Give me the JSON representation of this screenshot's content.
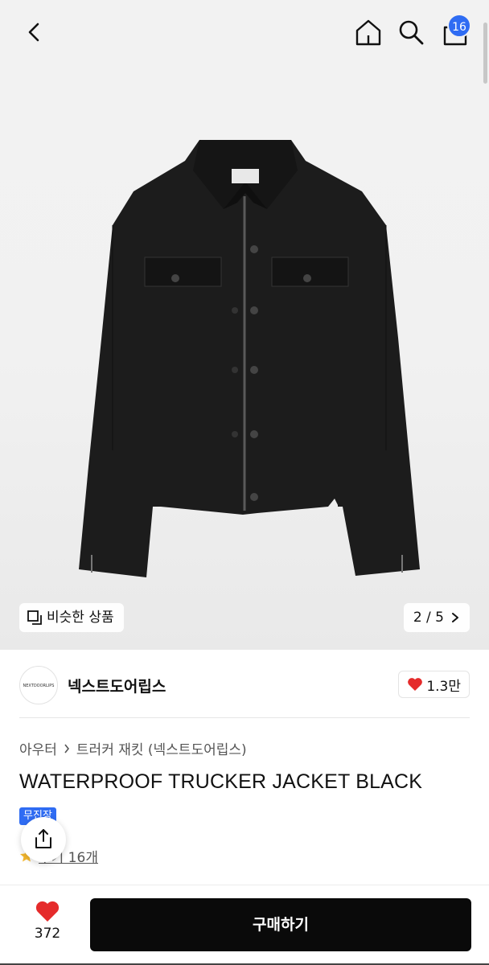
{
  "header": {
    "back_icon": "chevron-left-icon",
    "home_icon": "home-icon",
    "search_icon": "search-icon",
    "cart_icon": "shopping-bag-icon",
    "cart_badge": "16"
  },
  "gallery": {
    "similar_label": "비슷한 상품",
    "pager": "2 / 5"
  },
  "store": {
    "logo_text": "NEXTDOORLIPS",
    "name": "넥스트도어립스",
    "likes": "1.3만"
  },
  "breadcrumb": {
    "category": "아우터",
    "subcategory": "트러커 재킷 (넥스트도어립스)"
  },
  "product": {
    "title": "WATERPROOF TRUCKER JACKET BLACK",
    "badge": "무진장",
    "review_prefix": "후기",
    "review_text": "후기 16개"
  },
  "bottom_bar": {
    "wish_count": "372",
    "buy_label": "구매하기"
  },
  "colors": {
    "accent": "#2f6cf3",
    "heart": "#e52b2b",
    "buy_button": "#0a0a0a"
  }
}
